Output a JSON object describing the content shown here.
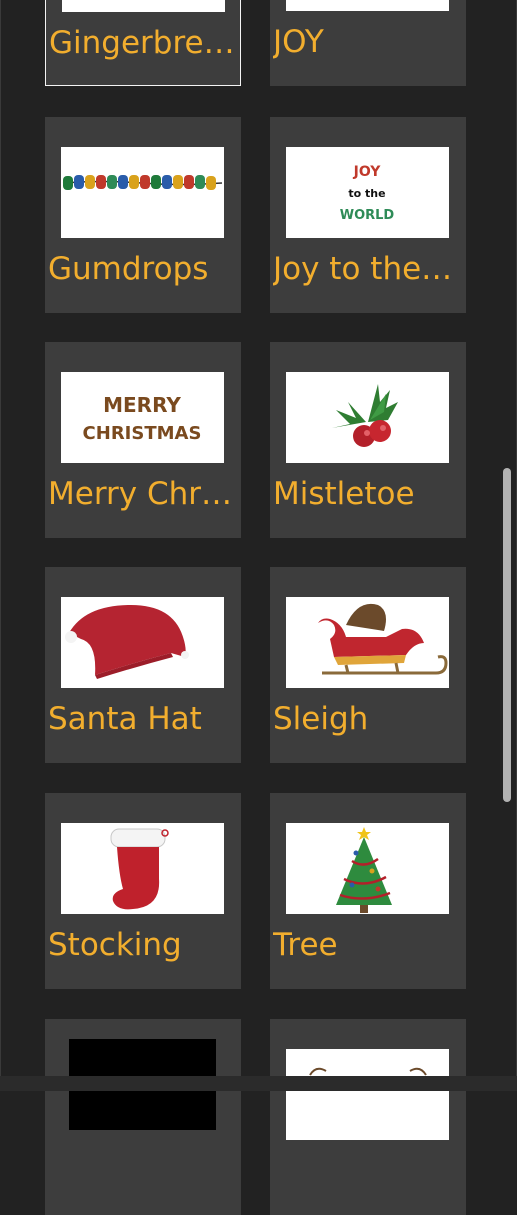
{
  "colors": {
    "background": "#222222",
    "tile": "#3d3d3d",
    "label": "#f2ae2e",
    "selected_border": "#f4f4f4",
    "scrollbar": "#b2b2b2"
  },
  "stickers": [
    {
      "label": "Gingerbrea...",
      "icon": "gingerbread-icon",
      "selected": true
    },
    {
      "label": "JOY",
      "icon": "joy-icon",
      "selected": false
    },
    {
      "label": "Gumdrops",
      "icon": "gumdrops-icon",
      "selected": false
    },
    {
      "label": "Joy to the ...",
      "icon": "joy-to-the-world-icon",
      "selected": false
    },
    {
      "label": "Merry Chri...",
      "icon": "merry-christmas-icon",
      "selected": false
    },
    {
      "label": "Mistletoe",
      "icon": "mistletoe-icon",
      "selected": false
    },
    {
      "label": "Santa Hat",
      "icon": "santa-hat-icon",
      "selected": false
    },
    {
      "label": "Sleigh",
      "icon": "sleigh-icon",
      "selected": false
    },
    {
      "label": "Stocking",
      "icon": "stocking-icon",
      "selected": false
    },
    {
      "label": "Tree",
      "icon": "tree-icon",
      "selected": false
    },
    {
      "label": "",
      "icon": "dark-sticker-icon",
      "selected": false
    },
    {
      "label": "",
      "icon": "reindeer-antlers-icon",
      "selected": false
    }
  ],
  "thumb_text": {
    "joy_line1": "JOY",
    "joy_line2": "to the",
    "joy_line3": "WORLD",
    "merry_line1": "MERRY",
    "merry_line2": "CHRISTMAS"
  }
}
